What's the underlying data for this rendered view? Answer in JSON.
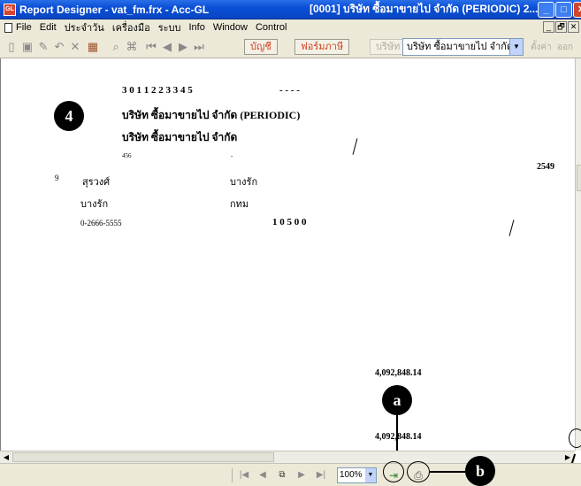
{
  "window": {
    "title_left": "Report Designer - vat_fm.frx - Acc-GL",
    "title_right": "[0001]  บริษัท ซื้อมาขายไป จำกัด (PERIODIC)  2...",
    "app_icon_text": "GL",
    "min_symbol": "_",
    "max_symbol": "□",
    "close_symbol": "✕"
  },
  "menu": {
    "items": [
      "File",
      "Edit",
      "ประจำวัน",
      "เครื่องมือ",
      "ระบบ",
      "Info",
      "Window",
      "Control"
    ],
    "mdi_min": "_",
    "mdi_restore": "🗗",
    "mdi_close": "✕"
  },
  "toolbar": {
    "account_button": "บัญชี",
    "tax_form_button": "ฟอร์มภาษี",
    "company_button": "บริษัท",
    "company_select_value": "บริษัท ซื้อมาขายไป จำกัด",
    "settings_label": "ตั้งค่า",
    "exit_label": "ออก"
  },
  "report": {
    "tax_id_digits": "3   0 1 1 2   2 3 3 4   5",
    "tax_id_dashes": "-   -   -   -",
    "company_periodic": "บริษัท ซื้อมาขายไป จำกัด (PERIODIC)",
    "company_name": "บริษัท ซื้อมาขายไป จำกัด",
    "house_no": "456",
    "dash_mark": "-",
    "year": "2549",
    "soi_no": "9",
    "road": "สุรวงศ์",
    "subdistrict": "บางรัก",
    "district": "บางรัก",
    "province": "กทม",
    "phone": "0-2666-5555",
    "postcode": "1 0 5 0 0",
    "amount_1": "4,092,848.14",
    "amount_2": "4,092,848.14"
  },
  "annotations": {
    "badge_4": "4",
    "badge_a": "a",
    "badge_b": "b"
  },
  "navbar": {
    "zoom_value": "100%"
  }
}
